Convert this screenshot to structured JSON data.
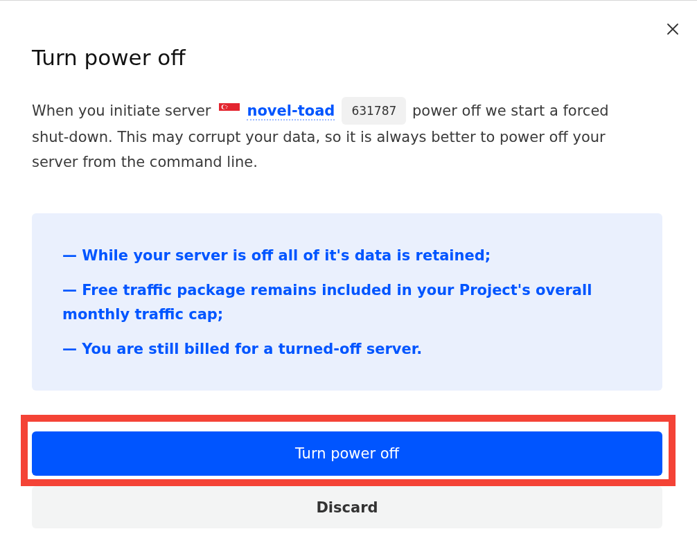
{
  "dialog": {
    "title": "Turn power off"
  },
  "message": {
    "text_before": "When you initiate server",
    "server_name": "novel-toad",
    "server_id": "631787",
    "text_after": "power off we start a forced shut-down. This may corrupt your data, so it is always better to power off your server from the command line."
  },
  "notes": [
    "— While your server is off all of it's data is retained;",
    "— Free traffic package remains included in your Project's overall monthly traffic cap;",
    "— You are still billed for a turned-off server."
  ],
  "buttons": [
    {
      "label": "Turn power off",
      "kind": "primary",
      "highlighted": true
    },
    {
      "label": "Discard",
      "kind": "secondary",
      "highlighted": false
    }
  ]
}
